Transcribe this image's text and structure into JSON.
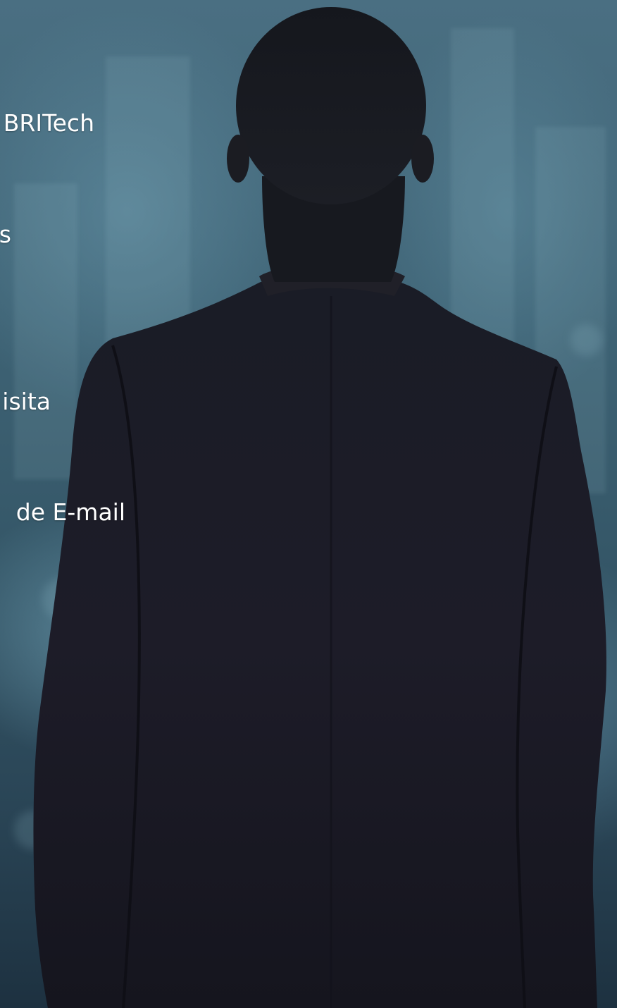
{
  "menu": {
    "items": [
      {
        "label": "BRITech"
      },
      {
        "label": "s"
      },
      {
        "label": "isita"
      },
      {
        "label": "de E-mail"
      }
    ]
  }
}
